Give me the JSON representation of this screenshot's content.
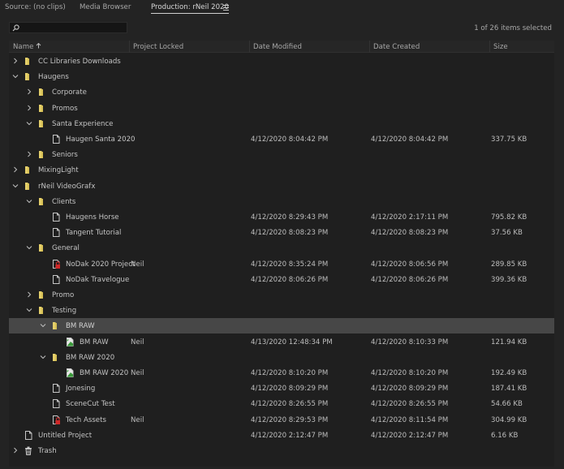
{
  "tabs": [
    {
      "label": "Source: (no clips)"
    },
    {
      "label": "Media Browser"
    },
    {
      "label": "Production: rNeil 2020"
    }
  ],
  "selection_count": "1 of 26 items selected",
  "search": {
    "value": "",
    "placeholder": ""
  },
  "columns": {
    "name": "Name",
    "locked": "Project Locked",
    "modified": "Date Modified",
    "created": "Date Created",
    "size": "Size"
  },
  "rows": [
    {
      "name": "CC Libraries Downloads",
      "kind": "folder",
      "expanded": false,
      "depth": 0
    },
    {
      "name": "Haugens",
      "kind": "folder",
      "expanded": true,
      "depth": 0
    },
    {
      "name": "Corporate",
      "kind": "folder",
      "expanded": false,
      "depth": 1
    },
    {
      "name": "Promos",
      "kind": "folder",
      "expanded": false,
      "depth": 1
    },
    {
      "name": "Santa Experience",
      "kind": "folder",
      "expanded": true,
      "depth": 1
    },
    {
      "name": "Haugen Santa 2020",
      "kind": "project",
      "depth": 2,
      "modified": "4/12/2020 8:04:42 PM",
      "created": "4/12/2020 8:04:42 PM",
      "size": "337.75 KB"
    },
    {
      "name": "Seniors",
      "kind": "folder",
      "expanded": false,
      "depth": 1
    },
    {
      "name": "MixingLight",
      "kind": "folder",
      "expanded": false,
      "depth": 0
    },
    {
      "name": "rNeil VideoGrafx",
      "kind": "folder",
      "expanded": true,
      "depth": 0
    },
    {
      "name": "Clients",
      "kind": "folder",
      "expanded": true,
      "depth": 1
    },
    {
      "name": "Haugens Horse",
      "kind": "project",
      "depth": 2,
      "modified": "4/12/2020 8:29:43 PM",
      "created": "4/12/2020 2:17:11 PM",
      "size": "795.82 KB"
    },
    {
      "name": "Tangent Tutorial",
      "kind": "project",
      "depth": 2,
      "modified": "4/12/2020 8:08:23 PM",
      "created": "4/12/2020 8:08:23 PM",
      "size": "37.56 KB"
    },
    {
      "name": "General",
      "kind": "folder",
      "expanded": true,
      "depth": 1
    },
    {
      "name": "NoDak 2020 Project",
      "kind": "project-locked",
      "depth": 2,
      "locked": "Neil",
      "modified": "4/12/2020 8:35:24 PM",
      "created": "4/12/2020 8:06:56 PM",
      "size": "289.85 KB"
    },
    {
      "name": "NoDak Travelogue",
      "kind": "project",
      "depth": 2,
      "modified": "4/12/2020 8:06:26 PM",
      "created": "4/12/2020 8:06:26 PM",
      "size": "399.36 KB"
    },
    {
      "name": "Promo",
      "kind": "folder",
      "expanded": false,
      "depth": 1
    },
    {
      "name": "Testing",
      "kind": "folder",
      "expanded": true,
      "depth": 1
    },
    {
      "name": "BM RAW",
      "kind": "folder",
      "expanded": true,
      "depth": 2,
      "selected": true
    },
    {
      "name": "BM RAW",
      "kind": "project-open",
      "depth": 3,
      "locked": "Neil",
      "modified": "4/13/2020 12:48:34 PM",
      "created": "4/12/2020 8:10:33 PM",
      "size": "121.94 KB"
    },
    {
      "name": "BM RAW 2020",
      "kind": "folder",
      "expanded": true,
      "depth": 2
    },
    {
      "name": "BM RAW 2020",
      "kind": "project-open",
      "depth": 3,
      "locked": "Neil",
      "modified": "4/12/2020 8:10:20 PM",
      "created": "4/12/2020 8:10:20 PM",
      "size": "192.49 KB"
    },
    {
      "name": "Jonesing",
      "kind": "project",
      "depth": 2,
      "modified": "4/12/2020 8:09:29 PM",
      "created": "4/12/2020 8:09:29 PM",
      "size": "187.41 KB"
    },
    {
      "name": "SceneCut Test",
      "kind": "project",
      "depth": 2,
      "modified": "4/12/2020 8:26:55 PM",
      "created": "4/12/2020 8:26:55 PM",
      "size": "54.66 KB"
    },
    {
      "name": "Tech Assets",
      "kind": "project-locked",
      "depth": 2,
      "locked": "Neil",
      "modified": "4/12/2020 8:29:53 PM",
      "created": "4/12/2020 8:11:54 PM",
      "size": "304.99 KB"
    },
    {
      "name": "Untitled Project",
      "kind": "project",
      "depth": 0,
      "modified": "4/12/2020 2:12:47 PM",
      "created": "4/12/2020 2:12:47 PM",
      "size": "6.16 KB"
    },
    {
      "name": "Trash",
      "kind": "trash",
      "expanded": false,
      "depth": 0
    }
  ]
}
